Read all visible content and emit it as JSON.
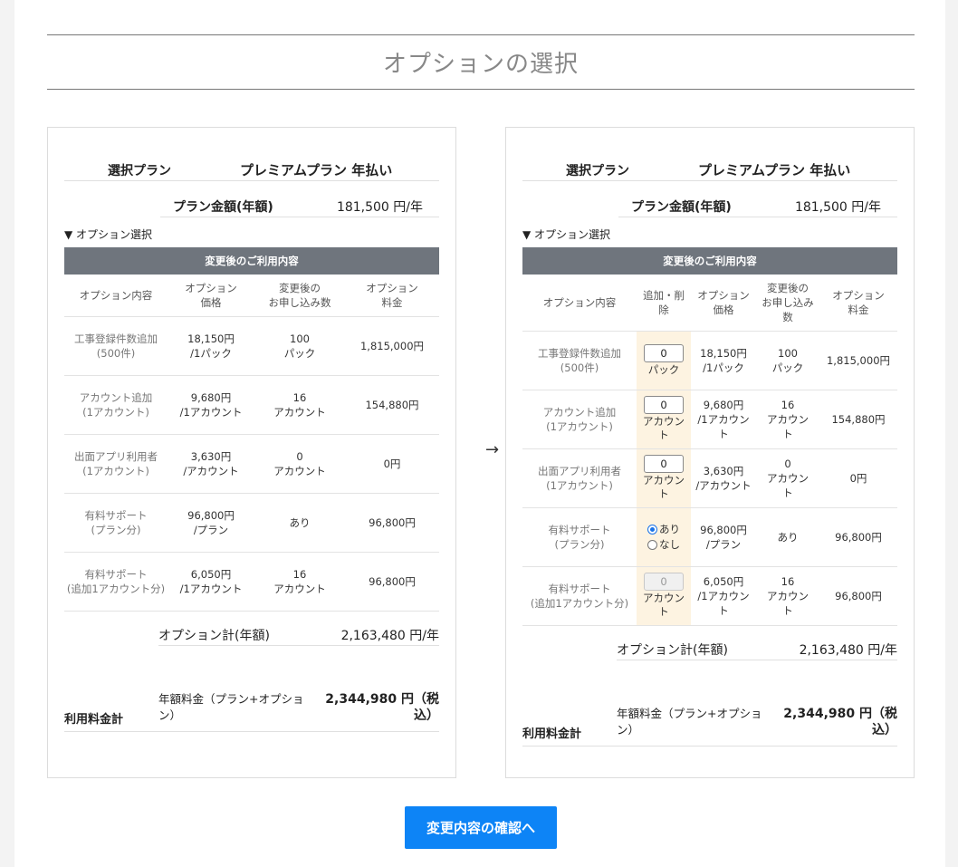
{
  "page": {
    "title": "オプションの選択"
  },
  "left_card": {
    "plan_label": "選択プラン",
    "plan_value": "プレミアムプラン 年払い",
    "price_label": "プラン金額(年額)",
    "price_value": "181,500 円/年",
    "options_toggle": "▼ オプション選択",
    "table_title": "変更後のご利用内容",
    "headers": {
      "content": "オプション内容",
      "price_1": "オプション",
      "price_2": "価格",
      "count_1": "変更後の",
      "count_2": "お申し込み数",
      "fee_1": "オプション",
      "fee_2": "料金"
    },
    "rows": [
      {
        "name_1": "工事登録件数追加",
        "name_2": "(500件)",
        "price_1": "18,150円",
        "price_2": "/1パック",
        "count_1": "100",
        "count_2": "パック",
        "fee": "1,815,000円"
      },
      {
        "name_1": "アカウント追加",
        "name_2": "(1アカウント)",
        "price_1": "9,680円",
        "price_2": "/1アカウント",
        "count_1": "16",
        "count_2": "アカウント",
        "fee": "154,880円"
      },
      {
        "name_1": "出面アプリ利用者",
        "name_2": "(1アカウント)",
        "price_1": "3,630円",
        "price_2": "/アカウント",
        "count_1": "0",
        "count_2": "アカウント",
        "fee": "0円"
      },
      {
        "name_1": "有料サポート",
        "name_2": "(プラン分)",
        "price_1": "96,800円",
        "price_2": "/プラン",
        "count_1": "あり",
        "count_2": "",
        "fee": "96,800円"
      },
      {
        "name_1": "有料サポート",
        "name_2": "(追加1アカウント分)",
        "price_1": "6,050円",
        "price_2": "/1アカウント",
        "count_1": "16",
        "count_2": "アカウント",
        "fee": "96,800円"
      }
    ],
    "option_total_label": "オプション計(年額)",
    "option_total_value": "2,163,480 円/年",
    "sum_label": "利用料金計",
    "sum_sub": "年額料金（プラン+オプション）",
    "sum_value": "2,344,980 円（税込）"
  },
  "arrow": "→",
  "right_card": {
    "plan_label": "選択プラン",
    "plan_value": "プレミアムプラン 年払い",
    "price_label": "プラン金額(年額)",
    "price_value": "181,500 円/年",
    "options_toggle": "▼ オプション選択",
    "table_title": "変更後のご利用内容",
    "headers": {
      "content": "オプション内容",
      "control": "追加・削除",
      "price_1": "オプション",
      "price_2": "価格",
      "count_1": "変更後の",
      "count_2": "お申し込み",
      "count_3": "数",
      "fee_1": "オプション",
      "fee_2": "料金"
    },
    "rows": [
      {
        "name_1": "工事登録件数追加",
        "name_2": "(500件)",
        "input_value": "0",
        "unit_1": "パック",
        "unit_2": "",
        "price_1": "18,150円",
        "price_2": "/1パック",
        "count_1": "100",
        "count_2": "パック",
        "count_3": "",
        "fee": "1,815,000円"
      },
      {
        "name_1": "アカウント追加",
        "name_2": "(1アカウント)",
        "input_value": "0",
        "unit_1": "アカウン",
        "unit_2": "ト",
        "price_1": "9,680円",
        "price_2": "/1アカウン",
        "price_3": "ト",
        "count_1": "16",
        "count_2": "アカウン",
        "count_3": "ト",
        "fee": "154,880円"
      },
      {
        "name_1": "出面アプリ利用者",
        "name_2": "(1アカウント)",
        "input_value": "0",
        "unit_1": "アカウン",
        "unit_2": "ト",
        "price_1": "3,630円",
        "price_2": "/アカウント",
        "price_3": "",
        "count_1": "0",
        "count_2": "アカウン",
        "count_3": "ト",
        "fee": "0円"
      },
      {
        "name_1": "有料サポート",
        "name_2": "(プラン分)",
        "radio_on": "あり",
        "radio_off": "なし",
        "price_1": "96,800円",
        "price_2": "/プラン",
        "price_3": "",
        "count_1": "あり",
        "count_2": "",
        "count_3": "",
        "fee": "96,800円"
      },
      {
        "name_1": "有料サポート",
        "name_2": "(追加1アカウント分)",
        "input_value": "0",
        "unit_1": "アカウン",
        "unit_2": "ト",
        "price_1": "6,050円",
        "price_2": "/1アカウン",
        "price_3": "ト",
        "count_1": "16",
        "count_2": "アカウン",
        "count_3": "ト",
        "fee": "96,800円"
      }
    ],
    "option_total_label": "オプション計(年額)",
    "option_total_value": "2,163,480 円/年",
    "sum_label": "利用料金計",
    "sum_sub": "年額料金（プラン+オプション）",
    "sum_value": "2,344,980 円（税込）"
  },
  "confirm_button": "変更内容の確認へ",
  "colors": {
    "accent": "#0d84f6",
    "table_header": "#6f757d",
    "control_bg": "#fdf3e1"
  }
}
